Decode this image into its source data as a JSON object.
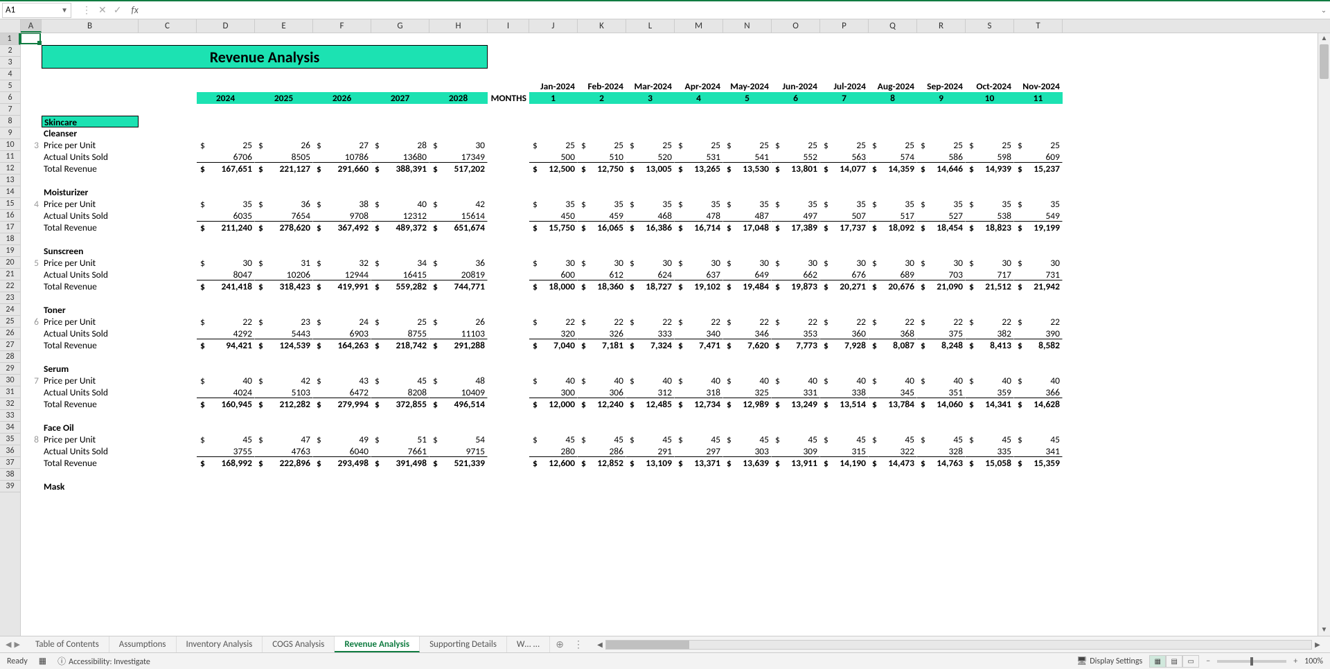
{
  "nameBox": "A1",
  "formula": "",
  "title": "Revenue Analysis",
  "columns": [
    "A",
    "B",
    "C",
    "D",
    "E",
    "F",
    "G",
    "H",
    "I",
    "J",
    "K",
    "L",
    "M",
    "N",
    "O",
    "P",
    "Q",
    "R",
    "S",
    "T"
  ],
  "years": [
    "2024",
    "2025",
    "2026",
    "2027",
    "2028"
  ],
  "monthsLabel": "MONTHS",
  "monthHeaders": [
    "Jan-2024",
    "Feb-2024",
    "Mar-2024",
    "Apr-2024",
    "May-2024",
    "Jun-2024",
    "Jul-2024",
    "Aug-2024",
    "Sep-2024",
    "Oct-2024",
    "Nov-2024"
  ],
  "monthNums": [
    "1",
    "2",
    "3",
    "4",
    "5",
    "6",
    "7",
    "8",
    "9",
    "10",
    "11"
  ],
  "category": "Skincare",
  "labels": {
    "price": "Price per Unit",
    "units": "Actual Units Sold",
    "total": "Total Revenue"
  },
  "products": [
    {
      "idx": "3",
      "name": "Cleanser",
      "price_y": [
        "25",
        "26",
        "27",
        "28",
        "30"
      ],
      "units_y": [
        "6706",
        "8505",
        "10786",
        "13680",
        "17349"
      ],
      "total_y": [
        "167,651",
        "221,127",
        "291,660",
        "388,391",
        "517,202"
      ],
      "price_m": [
        "25",
        "25",
        "25",
        "25",
        "25",
        "25",
        "25",
        "25",
        "25",
        "25",
        "25"
      ],
      "units_m": [
        "500",
        "510",
        "520",
        "531",
        "541",
        "552",
        "563",
        "574",
        "586",
        "598",
        "609"
      ],
      "total_m": [
        "12,500",
        "12,750",
        "13,005",
        "13,265",
        "13,530",
        "13,801",
        "14,077",
        "14,359",
        "14,646",
        "14,939",
        "15,237"
      ]
    },
    {
      "idx": "4",
      "name": "Moisturizer",
      "price_y": [
        "35",
        "36",
        "38",
        "40",
        "42"
      ],
      "units_y": [
        "6035",
        "7654",
        "9708",
        "12312",
        "15614"
      ],
      "total_y": [
        "211,240",
        "278,620",
        "367,492",
        "489,372",
        "651,674"
      ],
      "price_m": [
        "35",
        "35",
        "35",
        "35",
        "35",
        "35",
        "35",
        "35",
        "35",
        "35",
        "35"
      ],
      "units_m": [
        "450",
        "459",
        "468",
        "478",
        "487",
        "497",
        "507",
        "517",
        "527",
        "538",
        "549"
      ],
      "total_m": [
        "15,750",
        "16,065",
        "16,386",
        "16,714",
        "17,048",
        "17,389",
        "17,737",
        "18,092",
        "18,454",
        "18,823",
        "19,199"
      ]
    },
    {
      "idx": "5",
      "name": "Sunscreen",
      "price_y": [
        "30",
        "31",
        "32",
        "34",
        "36"
      ],
      "units_y": [
        "8047",
        "10206",
        "12944",
        "16415",
        "20819"
      ],
      "total_y": [
        "241,418",
        "318,423",
        "419,991",
        "559,282",
        "744,771"
      ],
      "price_m": [
        "30",
        "30",
        "30",
        "30",
        "30",
        "30",
        "30",
        "30",
        "30",
        "30",
        "30"
      ],
      "units_m": [
        "600",
        "612",
        "624",
        "637",
        "649",
        "662",
        "676",
        "689",
        "703",
        "717",
        "731"
      ],
      "total_m": [
        "18,000",
        "18,360",
        "18,727",
        "19,102",
        "19,484",
        "19,873",
        "20,271",
        "20,676",
        "21,090",
        "21,512",
        "21,942"
      ]
    },
    {
      "idx": "6",
      "name": "Toner",
      "price_y": [
        "22",
        "23",
        "24",
        "25",
        "26"
      ],
      "units_y": [
        "4292",
        "5443",
        "6903",
        "8755",
        "11103"
      ],
      "total_y": [
        "94,421",
        "124,539",
        "164,263",
        "218,742",
        "291,288"
      ],
      "price_m": [
        "22",
        "22",
        "22",
        "22",
        "22",
        "22",
        "22",
        "22",
        "22",
        "22",
        "22"
      ],
      "units_m": [
        "320",
        "326",
        "333",
        "340",
        "346",
        "353",
        "360",
        "368",
        "375",
        "382",
        "390"
      ],
      "total_m": [
        "7,040",
        "7,181",
        "7,324",
        "7,471",
        "7,620",
        "7,773",
        "7,928",
        "8,087",
        "8,248",
        "8,413",
        "8,582"
      ]
    },
    {
      "idx": "7",
      "name": "Serum",
      "price_y": [
        "40",
        "42",
        "43",
        "45",
        "48"
      ],
      "units_y": [
        "4024",
        "5103",
        "6472",
        "8208",
        "10409"
      ],
      "total_y": [
        "160,945",
        "212,282",
        "279,994",
        "372,855",
        "496,514"
      ],
      "price_m": [
        "40",
        "40",
        "40",
        "40",
        "40",
        "40",
        "40",
        "40",
        "40",
        "40",
        "40"
      ],
      "units_m": [
        "300",
        "306",
        "312",
        "318",
        "325",
        "331",
        "338",
        "345",
        "351",
        "359",
        "366"
      ],
      "total_m": [
        "12,000",
        "12,240",
        "12,485",
        "12,734",
        "12,989",
        "13,249",
        "13,514",
        "13,784",
        "14,060",
        "14,341",
        "14,628"
      ]
    },
    {
      "idx": "8",
      "name": "Face Oil",
      "price_y": [
        "45",
        "47",
        "49",
        "51",
        "54"
      ],
      "units_y": [
        "3755",
        "4763",
        "6040",
        "7661",
        "9715"
      ],
      "total_y": [
        "168,992",
        "222,896",
        "293,498",
        "391,498",
        "521,339"
      ],
      "price_m": [
        "45",
        "45",
        "45",
        "45",
        "45",
        "45",
        "45",
        "45",
        "45",
        "45",
        "45"
      ],
      "units_m": [
        "280",
        "286",
        "291",
        "297",
        "303",
        "309",
        "315",
        "322",
        "328",
        "335",
        "341"
      ],
      "total_m": [
        "12,600",
        "12,852",
        "13,109",
        "13,371",
        "13,639",
        "13,911",
        "14,190",
        "14,473",
        "14,763",
        "15,058",
        "15,359"
      ]
    }
  ],
  "lastProduct": "Mask",
  "tabs": [
    "Table of Contents",
    "Assumptions",
    "Inventory Analysis",
    "COGS Analysis",
    "Revenue Analysis",
    "Supporting Details",
    "W… ..."
  ],
  "activeTab": 4,
  "status": {
    "ready": "Ready",
    "accessibility": "Accessibility: Investigate",
    "display": "Display Settings",
    "zoom": "100%"
  }
}
